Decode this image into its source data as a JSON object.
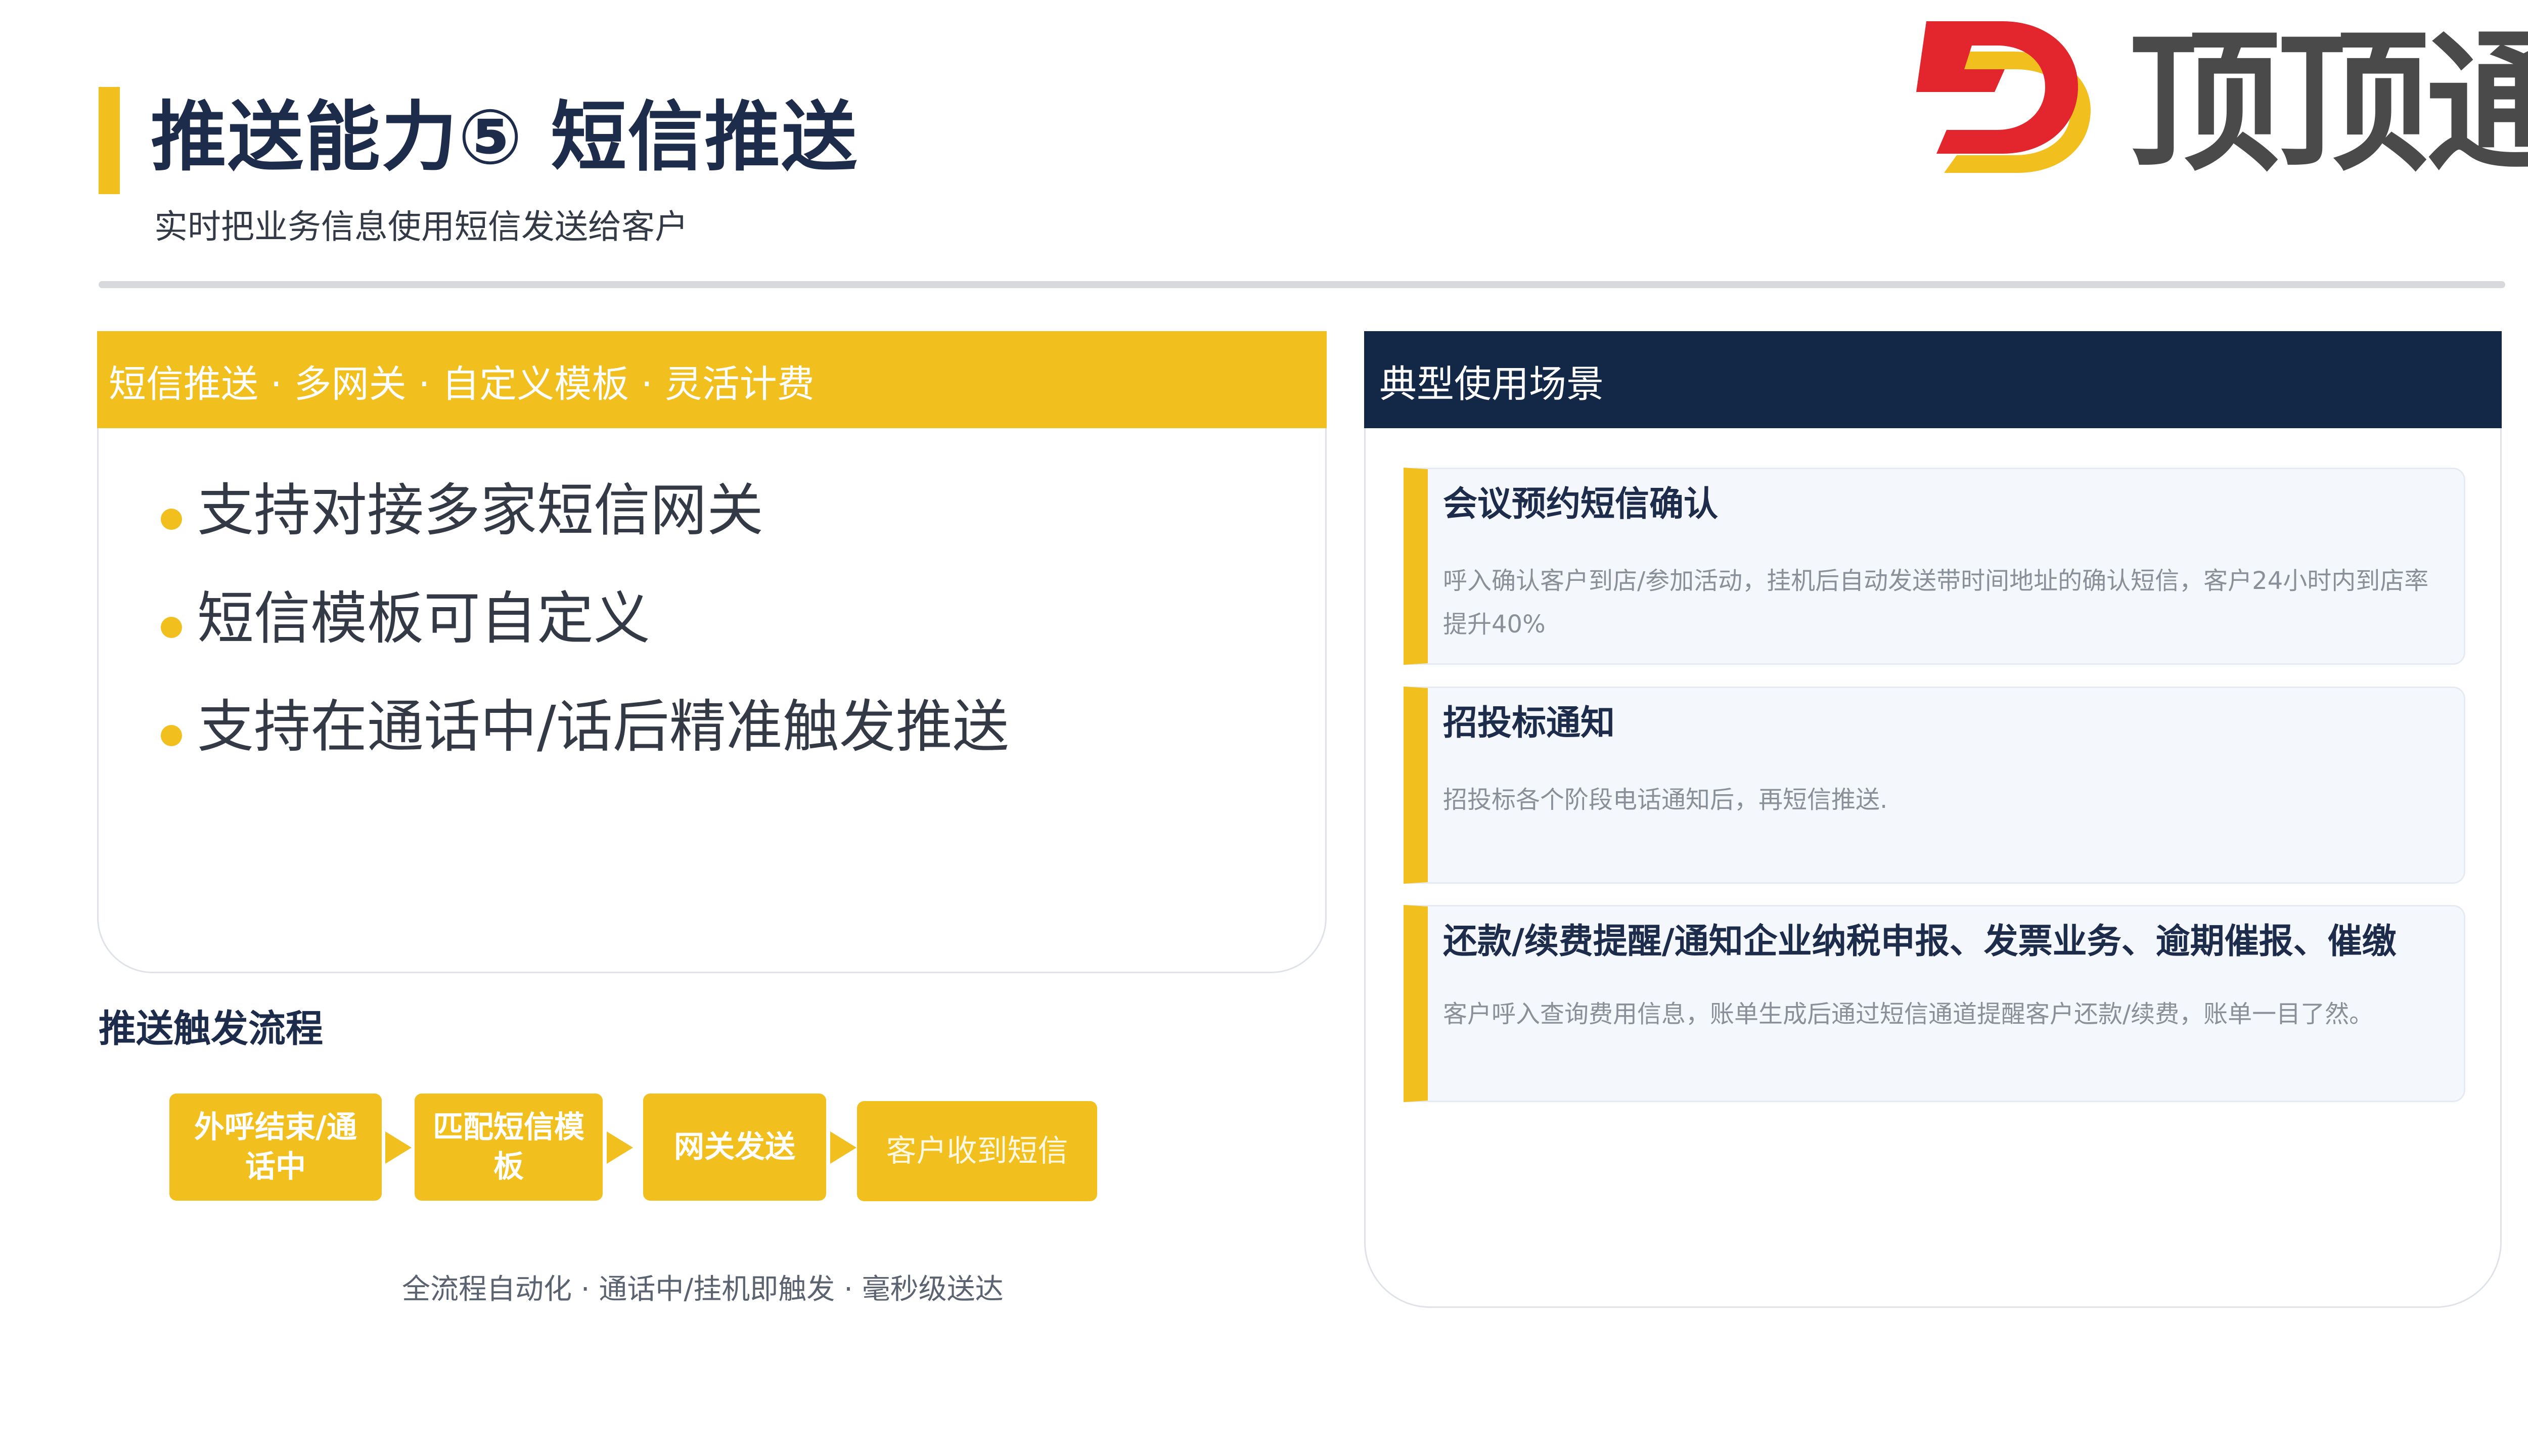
{
  "header": {
    "title": "推送能力⑤ 短信推送",
    "subtitle": "实时把业务信息使用短信发送给客户"
  },
  "logo": {
    "text": "顶顶通",
    "icon": "dingdingtong-d-logo",
    "colors": {
      "red": "#e3262e",
      "yellow": "#f1bf1e",
      "text": "#4a4a4a"
    }
  },
  "left_panel": {
    "header": "短信推送 · 多网关 · 自定义模板 · 灵活计费",
    "features": [
      "支持对接多家短信网关",
      "短信模板可自定义",
      "支持在通话中/话后精准触发推送"
    ]
  },
  "flow": {
    "title": "推送触发流程",
    "steps": [
      "外呼结束/通话中",
      "匹配短信模板",
      "网关发送",
      "客户收到短信"
    ],
    "caption": "全流程自动化 · 通话中/挂机即触发 · 毫秒级送达"
  },
  "right_panel": {
    "header": "典型使用场景",
    "scenarios": [
      {
        "title": "会议预约短信确认",
        "desc": "呼入确认客户到店/参加活动，挂机后自动发送带时间地址的确认短信，客户24小时内到店率提升40%"
      },
      {
        "title": "招投标通知",
        "desc": "招投标各个阶段电话通知后，再短信推送."
      },
      {
        "title": "还款/续费提醒/通知企业纳税申报、发票业务、逾期催报、催缴",
        "desc": "客户呼入查询费用信息，账单生成后通过短信通道提醒客户还款/续费，账单一目了然。"
      }
    ]
  },
  "colors": {
    "accent_yellow": "#f1bf1e",
    "navy": "#132847",
    "title_text": "#1e2c4c"
  }
}
